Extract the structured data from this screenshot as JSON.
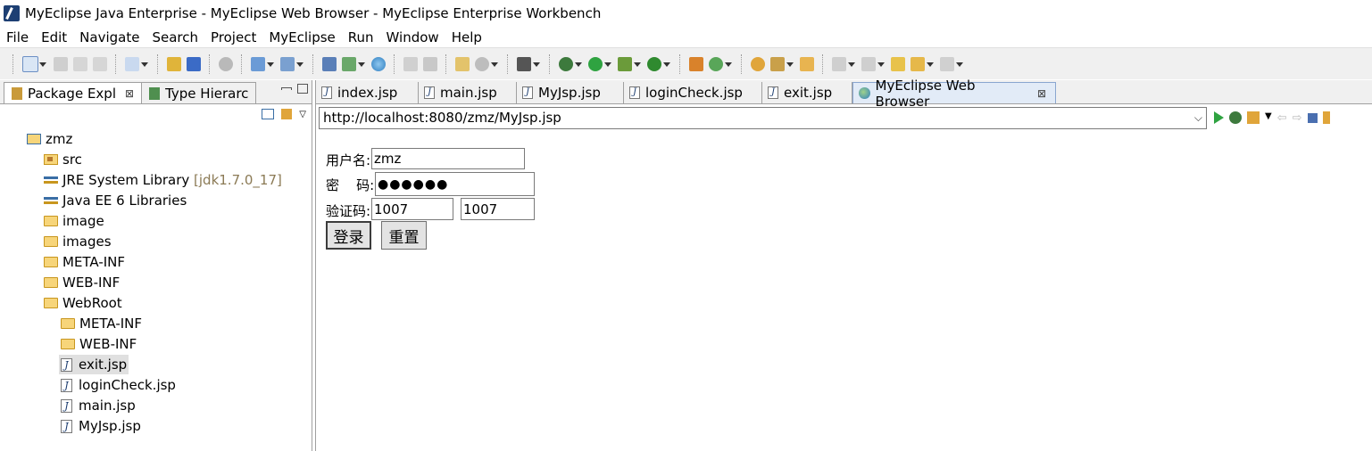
{
  "window": {
    "title": "MyEclipse Java Enterprise - MyEclipse Web Browser - MyEclipse Enterprise Workbench"
  },
  "menu": [
    "File",
    "Edit",
    "Navigate",
    "Search",
    "Project",
    "MyEclipse",
    "Run",
    "Window",
    "Help"
  ],
  "left_tabs": [
    {
      "label": "Package Expl",
      "close": "⊠"
    },
    {
      "label": "Type Hierarc"
    }
  ],
  "tree": [
    {
      "label": "zmz",
      "kind": "project"
    },
    {
      "label": "src",
      "kind": "pkgfolder"
    },
    {
      "label": "JRE System Library",
      "hint": "[jdk1.7.0_17]",
      "kind": "library"
    },
    {
      "label": "Java EE 6 Libraries",
      "kind": "library"
    },
    {
      "label": "image",
      "kind": "folder"
    },
    {
      "label": "images",
      "kind": "folder"
    },
    {
      "label": "META-INF",
      "kind": "folder"
    },
    {
      "label": "WEB-INF",
      "kind": "folder"
    },
    {
      "label": "WebRoot",
      "kind": "folder"
    },
    {
      "label": "META-INF",
      "kind": "folder"
    },
    {
      "label": "WEB-INF",
      "kind": "folder"
    },
    {
      "label": "exit.jsp",
      "kind": "jsp"
    },
    {
      "label": "loginCheck.jsp",
      "kind": "jsp"
    },
    {
      "label": "main.jsp",
      "kind": "jsp"
    },
    {
      "label": "MyJsp.jsp",
      "kind": "jsp"
    }
  ],
  "editor_tabs": [
    {
      "label": "index.jsp"
    },
    {
      "label": "main.jsp"
    },
    {
      "label": "MyJsp.jsp"
    },
    {
      "label": "loginCheck.jsp"
    },
    {
      "label": "exit.jsp"
    },
    {
      "label": "MyEclipse Web Browser",
      "close": "⊠"
    }
  ],
  "browser": {
    "url": "http://localhost:8080/zmz/MyJsp.jsp",
    "form": {
      "username_label": "用户名:",
      "username_value": "zmz",
      "password_label": "密    码:",
      "password_value": "●●●●●●",
      "captcha_label": "验证码:",
      "captcha_value": "1007",
      "captcha_shown": "1007",
      "login_button": "登录",
      "reset_button": "重置"
    }
  }
}
